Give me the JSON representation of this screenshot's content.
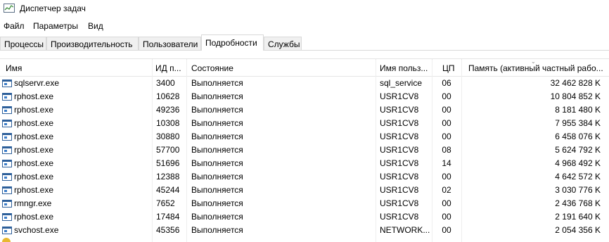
{
  "window": {
    "title": "Диспетчер задач",
    "icon": "task-manager-icon"
  },
  "menu": [
    "Файл",
    "Параметры",
    "Вид"
  ],
  "tabs": [
    {
      "label": "Процессы",
      "active": false
    },
    {
      "label": "Производительность",
      "active": false
    },
    {
      "label": "Пользователи",
      "active": false
    },
    {
      "label": "Подробности",
      "active": true
    },
    {
      "label": "Службы",
      "active": false
    }
  ],
  "columns": {
    "name": "Имя",
    "pid": "ИД п...",
    "status": "Состояние",
    "user": "Имя польз...",
    "cpu": "ЦП",
    "memory": "Память (активный частный рабо..."
  },
  "rows": [
    {
      "name": "sqlservr.exe",
      "pid": "3400",
      "status": "Выполняется",
      "user": "sql_service",
      "cpu": "06",
      "memory": "32 462 828 K"
    },
    {
      "name": "rphost.exe",
      "pid": "10628",
      "status": "Выполняется",
      "user": "USR1CV8",
      "cpu": "00",
      "memory": "10 804 852 K"
    },
    {
      "name": "rphost.exe",
      "pid": "49236",
      "status": "Выполняется",
      "user": "USR1CV8",
      "cpu": "00",
      "memory": "8 181 480 K"
    },
    {
      "name": "rphost.exe",
      "pid": "10308",
      "status": "Выполняется",
      "user": "USR1CV8",
      "cpu": "00",
      "memory": "7 955 384 K"
    },
    {
      "name": "rphost.exe",
      "pid": "30880",
      "status": "Выполняется",
      "user": "USR1CV8",
      "cpu": "00",
      "memory": "6 458 076 K"
    },
    {
      "name": "rphost.exe",
      "pid": "57700",
      "status": "Выполняется",
      "user": "USR1CV8",
      "cpu": "08",
      "memory": "5 624 792 K"
    },
    {
      "name": "rphost.exe",
      "pid": "51696",
      "status": "Выполняется",
      "user": "USR1CV8",
      "cpu": "14",
      "memory": "4 968 492 K"
    },
    {
      "name": "rphost.exe",
      "pid": "12388",
      "status": "Выполняется",
      "user": "USR1CV8",
      "cpu": "00",
      "memory": "4 642 572 K"
    },
    {
      "name": "rphost.exe",
      "pid": "45244",
      "status": "Выполняется",
      "user": "USR1CV8",
      "cpu": "02",
      "memory": "3 030 776 K"
    },
    {
      "name": "rmngr.exe",
      "pid": "7652",
      "status": "Выполняется",
      "user": "USR1CV8",
      "cpu": "00",
      "memory": "2 436 768 K"
    },
    {
      "name": "rphost.exe",
      "pid": "17484",
      "status": "Выполняется",
      "user": "USR1CV8",
      "cpu": "00",
      "memory": "2 191 640 K"
    },
    {
      "name": "svchost.exe",
      "pid": "45356",
      "status": "Выполняется",
      "user": "NETWORK...",
      "cpu": "00",
      "memory": "2 054 356 K"
    }
  ]
}
